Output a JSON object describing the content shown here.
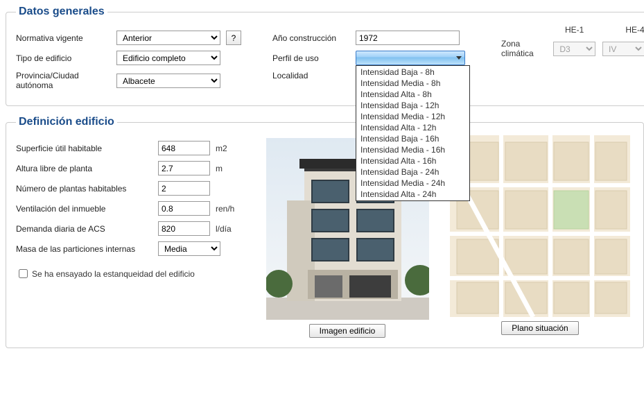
{
  "datos": {
    "legend": "Datos generales",
    "normativa_label": "Normativa vigente",
    "normativa_value": "Anterior",
    "help": "?",
    "tipo_label": "Tipo de edificio",
    "tipo_value": "Edificio completo",
    "provincia_label": "Provincia/Ciudad autónoma",
    "provincia_value": "Albacete",
    "ano_label": "Año construcción",
    "ano_value": "1972",
    "perfil_label": "Perfil de uso",
    "perfil_options": [
      "Intensidad Baja - 8h",
      "Intensidad Media - 8h",
      "Intensidad Alta - 8h",
      "Intensidad Baja - 12h",
      "Intensidad Media - 12h",
      "Intensidad Alta - 12h",
      "Intensidad Baja - 16h",
      "Intensidad Media - 16h",
      "Intensidad Alta - 16h",
      "Intensidad Baja - 24h",
      "Intensidad Media - 24h",
      "Intensidad Alta - 24h"
    ],
    "localidad_label": "Localidad",
    "he1": "HE-1",
    "he4": "HE-4",
    "zona_label": "Zona climática",
    "zona_he1": "D3",
    "zona_he4": "IV"
  },
  "def": {
    "legend": "Definición edificio",
    "superficie_label": "Superficie útil habitable",
    "superficie_value": "648",
    "superficie_unit": "m2",
    "altura_label": "Altura libre de planta",
    "altura_value": "2.7",
    "altura_unit": "m",
    "plantas_label": "Número de plantas habitables",
    "plantas_value": "2",
    "vent_label": "Ventilación del inmueble",
    "vent_value": "0.8",
    "vent_unit": "ren/h",
    "acs_label": "Demanda diaria de ACS",
    "acs_value": "820",
    "acs_unit": "l/día",
    "masa_label": "Masa de las particiones internas",
    "masa_value": "Media",
    "estanq_label": "Se ha ensayado la estanqueidad del edificio",
    "imagen_btn": "Imagen edificio",
    "plano_btn": "Plano situación"
  }
}
